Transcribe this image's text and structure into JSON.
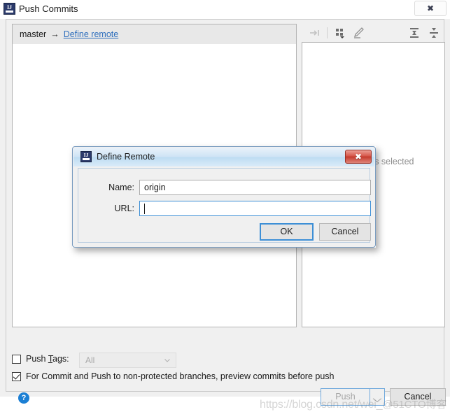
{
  "window": {
    "title": "Push Commits",
    "app_icon": "intellij-idea-icon",
    "close_label": "✕"
  },
  "left_panel": {
    "branch_row": {
      "branch": "master",
      "arrow": "→",
      "link": "Define remote"
    }
  },
  "right_panel": {
    "empty_text": "No commits selected",
    "toolbar": [
      {
        "name": "cherry-pick-icon",
        "tooltip": "Cherry-Pick",
        "disabled": true
      },
      {
        "name": "grid-columns-icon",
        "tooltip": "Show Columns",
        "disabled": false
      },
      {
        "name": "pencil-edit-icon",
        "tooltip": "Edit",
        "disabled": false
      },
      {
        "name": "expand-all-icon",
        "tooltip": "Expand All",
        "disabled": false
      },
      {
        "name": "collapse-all-icon",
        "tooltip": "Collapse All",
        "disabled": false
      }
    ]
  },
  "options": {
    "push_tags": {
      "label_pre": "Push ",
      "label_mnemonic": "T",
      "label_post": "ags:",
      "checked": false,
      "combo_value": "All",
      "combo_disabled": true
    },
    "preview_commits": {
      "label": "For Commit and Push to non-protected branches, preview commits before push",
      "checked": true
    }
  },
  "footer": {
    "help_label": "?",
    "push_label": "Push",
    "push_disabled": true,
    "cancel_label": "Cancel"
  },
  "watermark": {
    "url": "https://blog.csdn.net/wei_",
    "suffix": "@51CTO博客"
  },
  "modal": {
    "title": "Define Remote",
    "app_icon": "intellij-idea-icon",
    "close_label": "✕",
    "name_label": "Name:",
    "name_value": "origin",
    "url_label": "URL:",
    "url_value": "",
    "ok_label": "OK",
    "cancel_label": "Cancel"
  },
  "colors": {
    "link": "#2f6fbd",
    "focus_border": "#3d8fd6",
    "close_red": "#c4392c",
    "help_blue": "#1b7fd4",
    "muted_text": "#8e8e8e"
  }
}
